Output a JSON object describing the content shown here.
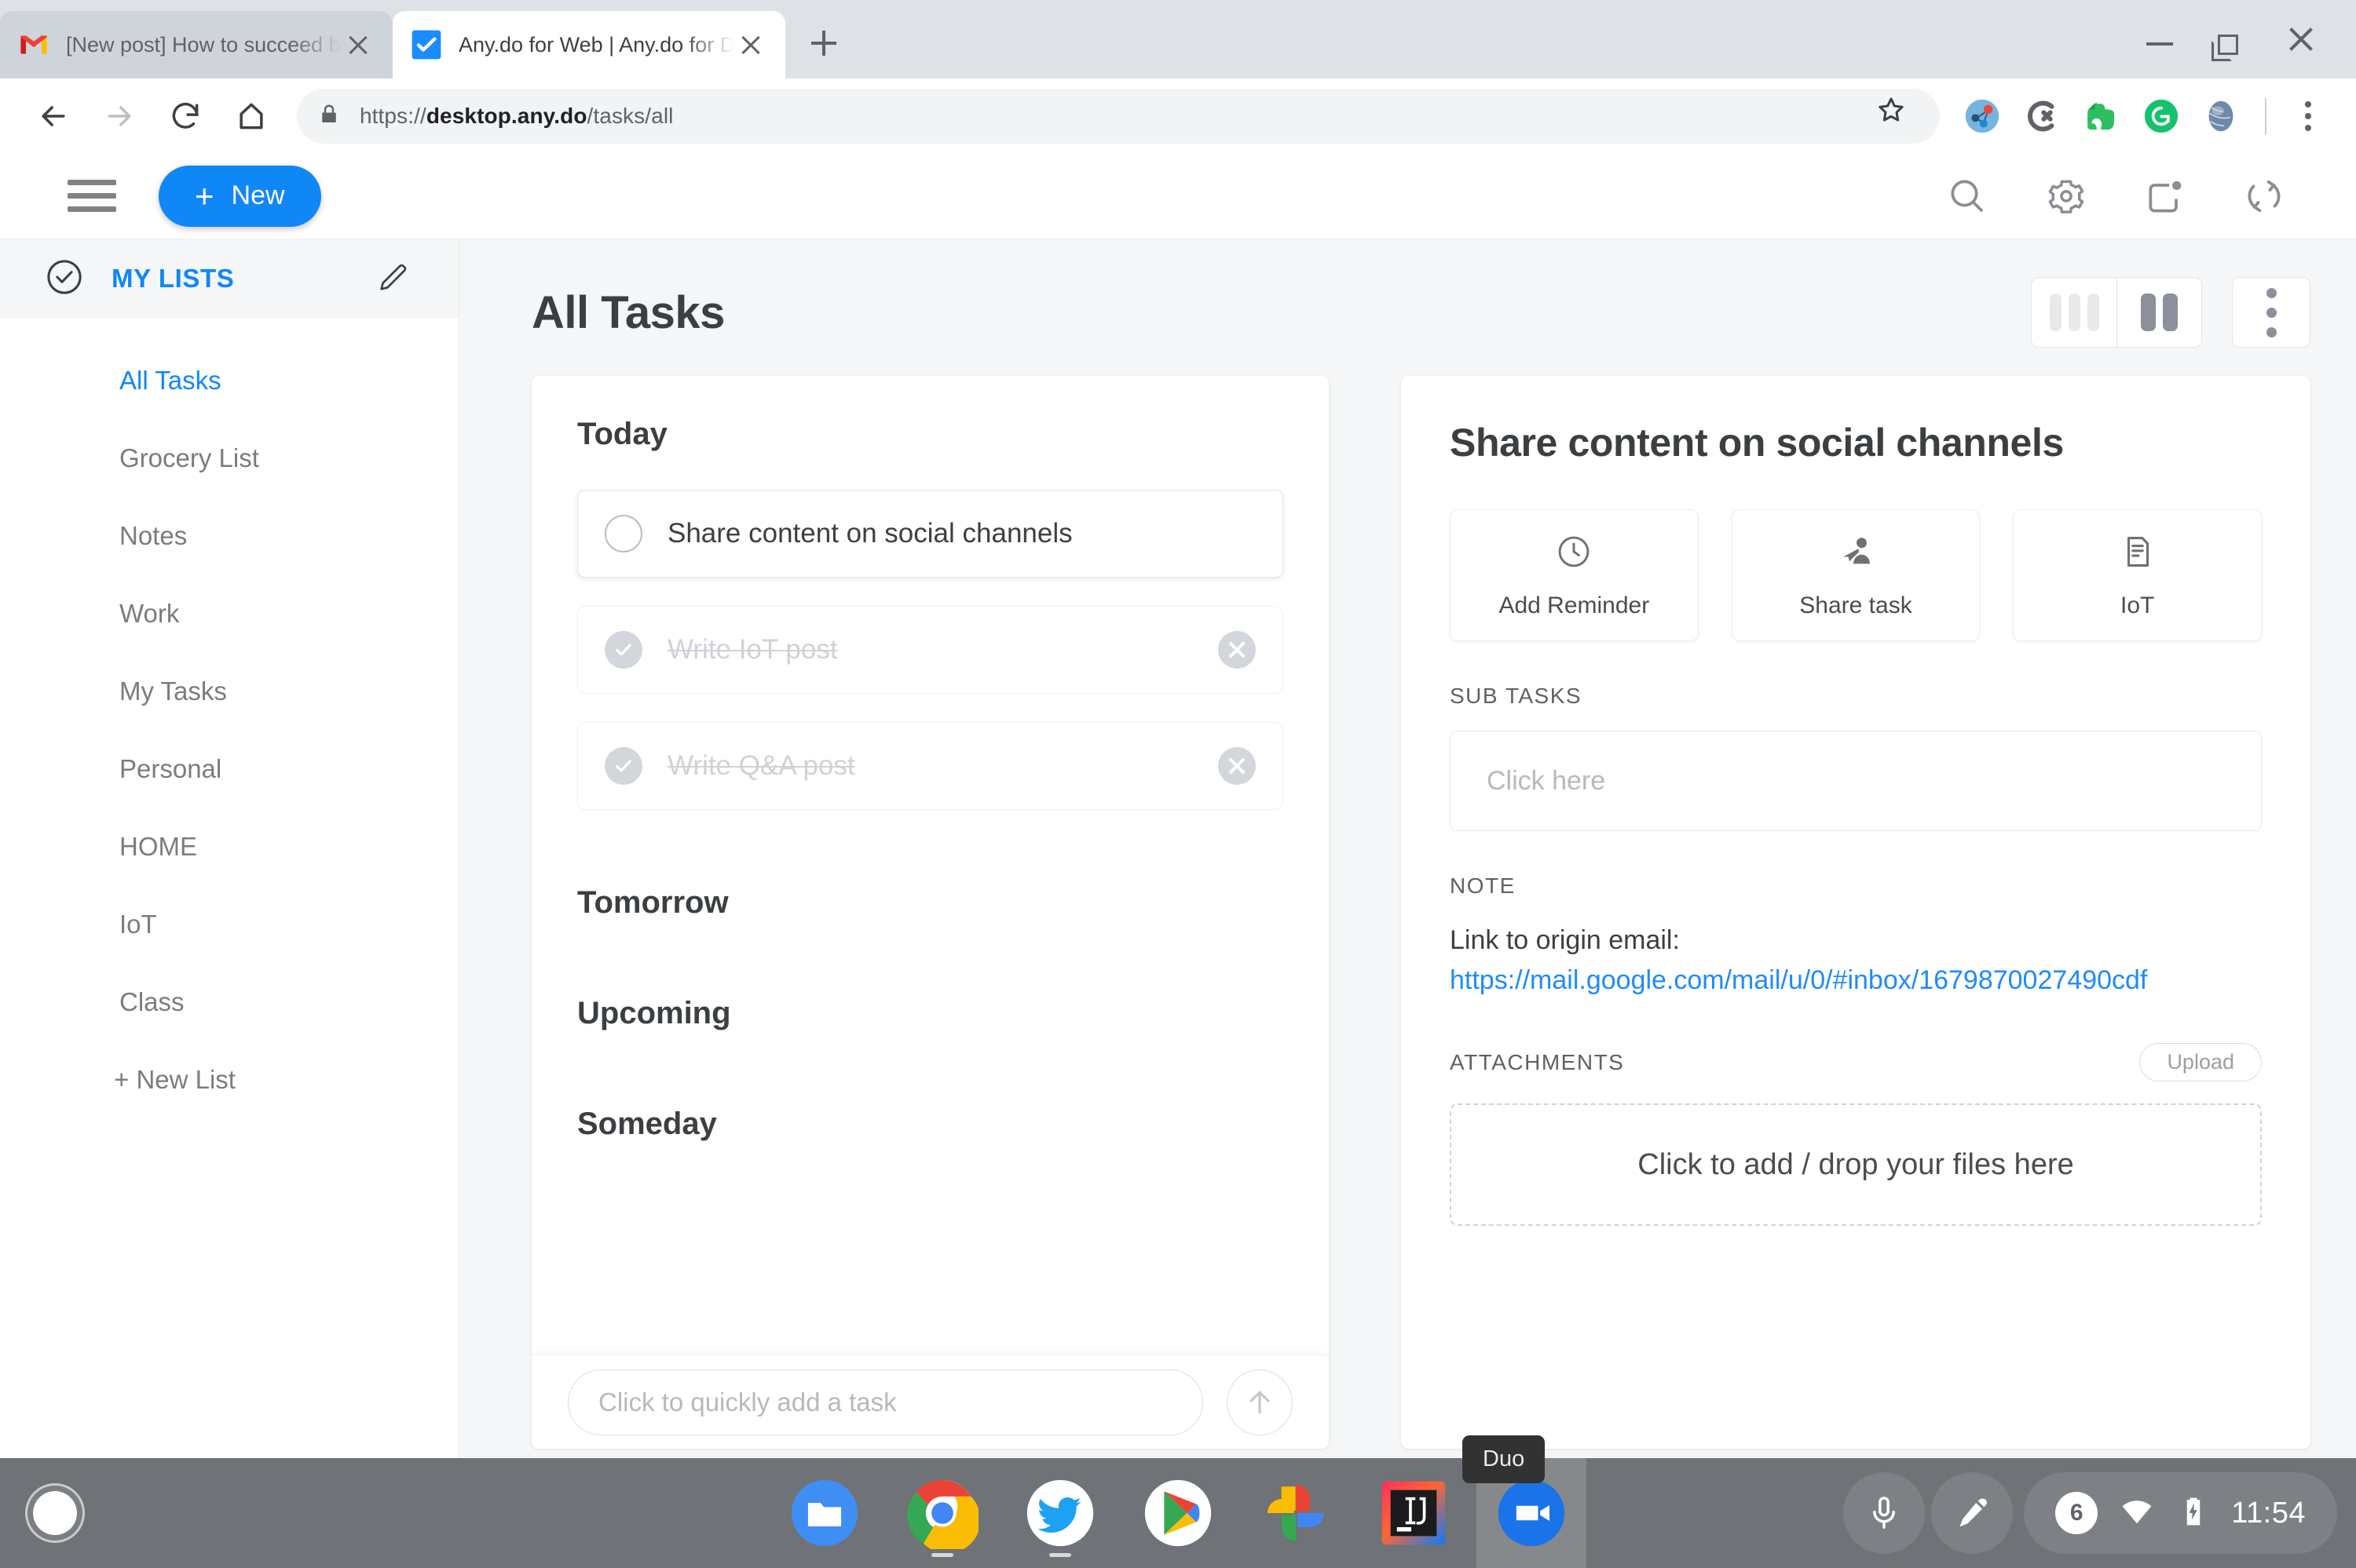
{
  "browser": {
    "tabs": [
      {
        "title": "[New post] How to succeed bu",
        "favicon": "gmail-icon",
        "active": false
      },
      {
        "title": "Any.do for Web | Any.do for De",
        "favicon": "anydo-icon",
        "active": true
      }
    ],
    "new_tab_label": "+",
    "window_controls": {
      "minimize": "minimize-icon",
      "maximize": "restore-icon",
      "close": "close-icon"
    },
    "nav": {
      "back": "back-arrow-icon",
      "forward": "forward-arrow-icon",
      "reload": "reload-icon",
      "home": "home-icon"
    },
    "omnibox": {
      "lock": "lock-icon",
      "url_scheme": "https://",
      "url_host": "desktop.any.do",
      "url_path": "/tasks/all",
      "bookmark": "star-icon"
    },
    "extensions": [
      {
        "name": "network-share-extension-icon"
      },
      {
        "name": "clockify-extension-icon"
      },
      {
        "name": "evernote-extension-icon"
      },
      {
        "name": "grammarly-extension-icon"
      },
      {
        "name": "globe-extension-icon"
      }
    ],
    "menu": "browser-menu-icon"
  },
  "app_header": {
    "menu_icon": "hamburger-icon",
    "new_button": "New",
    "new_button_plus": "+",
    "icons": [
      "search-icon",
      "gear-icon",
      "notifications-icon",
      "sync-icon"
    ]
  },
  "sidebar": {
    "header": {
      "label": "MY LISTS",
      "check_icon": "check-circle-icon",
      "edit_icon": "pencil-icon"
    },
    "items": [
      {
        "label": "All Tasks",
        "active": true
      },
      {
        "label": "Grocery List",
        "active": false
      },
      {
        "label": "Notes",
        "active": false
      },
      {
        "label": "Work",
        "active": false
      },
      {
        "label": "My Tasks",
        "active": false
      },
      {
        "label": "Personal",
        "active": false
      },
      {
        "label": "HOME",
        "active": false
      },
      {
        "label": "IoT",
        "active": false
      },
      {
        "label": "Class",
        "active": false
      }
    ],
    "new_list": "+ New List"
  },
  "main": {
    "page_title": "All Tasks",
    "view_toggle": {
      "three_column": "three-column-view-icon",
      "two_column": "two-column-view-icon",
      "active": "two_column"
    },
    "more_menu": "more-options-icon",
    "sections": [
      {
        "title": "Today",
        "tasks": [
          {
            "text": "Share content on social channels",
            "done": false,
            "selected": true
          },
          {
            "text": "Write IoT post",
            "done": true,
            "selected": false
          },
          {
            "text": "Write Q&A post",
            "done": true,
            "selected": false
          }
        ]
      },
      {
        "title": "Tomorrow",
        "tasks": []
      },
      {
        "title": "Upcoming",
        "tasks": []
      },
      {
        "title": "Someday",
        "tasks": []
      }
    ],
    "quick_add_placeholder": "Click to quickly add a task",
    "quick_add_send": "send-arrow-icon"
  },
  "detail": {
    "title": "Share content on social channels",
    "actions": [
      {
        "label": "Add Reminder",
        "icon": "clock-icon"
      },
      {
        "label": "Share task",
        "icon": "share-person-icon"
      },
      {
        "label": "IoT",
        "icon": "list-document-icon"
      }
    ],
    "sub_tasks_label": "SUB TASKS",
    "sub_tasks_placeholder": "Click here",
    "note_label": "NOTE",
    "note_text": "Link to origin email:",
    "note_link": "https://mail.google.com/mail/u/0/#inbox/1679870027490cdf",
    "attachments_label": "ATTACHMENTS",
    "upload_label": "Upload",
    "dropzone_text": "Click to add / drop your files here"
  },
  "shelf": {
    "launcher": "launcher-icon",
    "apps": [
      {
        "name": "files-app-icon",
        "label": "Files",
        "running": false
      },
      {
        "name": "chrome-app-icon",
        "label": "Chrome",
        "running": true
      },
      {
        "name": "twitter-app-icon",
        "label": "Twitter",
        "running": true
      },
      {
        "name": "play-store-app-icon",
        "label": "Play Store",
        "running": false
      },
      {
        "name": "google-photos-app-icon",
        "label": "Photos",
        "running": false
      },
      {
        "name": "intellij-idea-app-icon",
        "label": "IntelliJ IDEA",
        "running": false
      },
      {
        "name": "duo-app-icon",
        "label": "Duo",
        "running": false,
        "highlighted": true
      }
    ],
    "tooltip": "Duo",
    "tray": {
      "mic": "microphone-icon",
      "stylus": "stylus-icon",
      "notification_count": "6",
      "wifi": "wifi-icon",
      "battery": "battery-charging-icon",
      "time": "11:54"
    }
  },
  "colors": {
    "accent": "#0f87f7",
    "link": "#1f8cf7",
    "shelf": "#6f7276"
  }
}
